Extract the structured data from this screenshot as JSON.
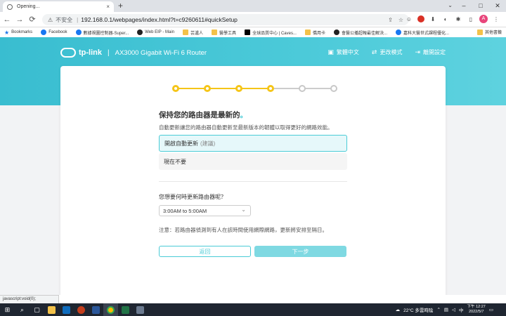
{
  "browser": {
    "tab_title": "Opening...",
    "tab_close": "×",
    "new_tab": "+",
    "security_label": "不安全",
    "url": "192.168.0.1/webpages/index.html?t=c9260611#quickSetup",
    "window_controls": [
      "–",
      "□",
      "✕"
    ]
  },
  "bookmarks": {
    "items": [
      "Bookmarks",
      "Facebook",
      "數據視圖控制器-Super...",
      "Web EIP - Main",
      "芸瀘人",
      "醫學工具",
      "全球品質中心 | Caves...",
      "僑用卡",
      "會醫公播超報最佳解決...",
      "嘉科大醫世式課程優化..."
    ],
    "other": "其他書籤"
  },
  "router": {
    "brand": "tp-link",
    "divider": "|",
    "model": "AX3000 Gigabit Wi-Fi 6 Router",
    "language": "繁體中文",
    "change_mode": "更改模式",
    "exit_setup": "離開設定"
  },
  "stepper": {
    "total": 6,
    "completed": 4
  },
  "wizard": {
    "title": "保持您的路由器是最新的",
    "title_dot": "。",
    "description": "自動更新讓您的路由器自動更新至最新版本的韌體以取得更好的網路效能。",
    "option_enable": "開啟自動更新",
    "option_enable_recommended": "(建議)",
    "option_later": "現在不要",
    "time_question": "您想要何時更新路由器呢？",
    "time_selected": "3:00AM to 5:00AM",
    "note": "注意：若路由器偵測到有人在該時間使用網際網路，更新將安排至隔日。",
    "back_label": "返回",
    "next_label": "下一步"
  },
  "status_bar": "javascript:void(0);",
  "taskbar": {
    "weather": "22°C 多雲時陰",
    "time": "下午 12:27",
    "date": "2022/5/7",
    "lang": "中"
  }
}
